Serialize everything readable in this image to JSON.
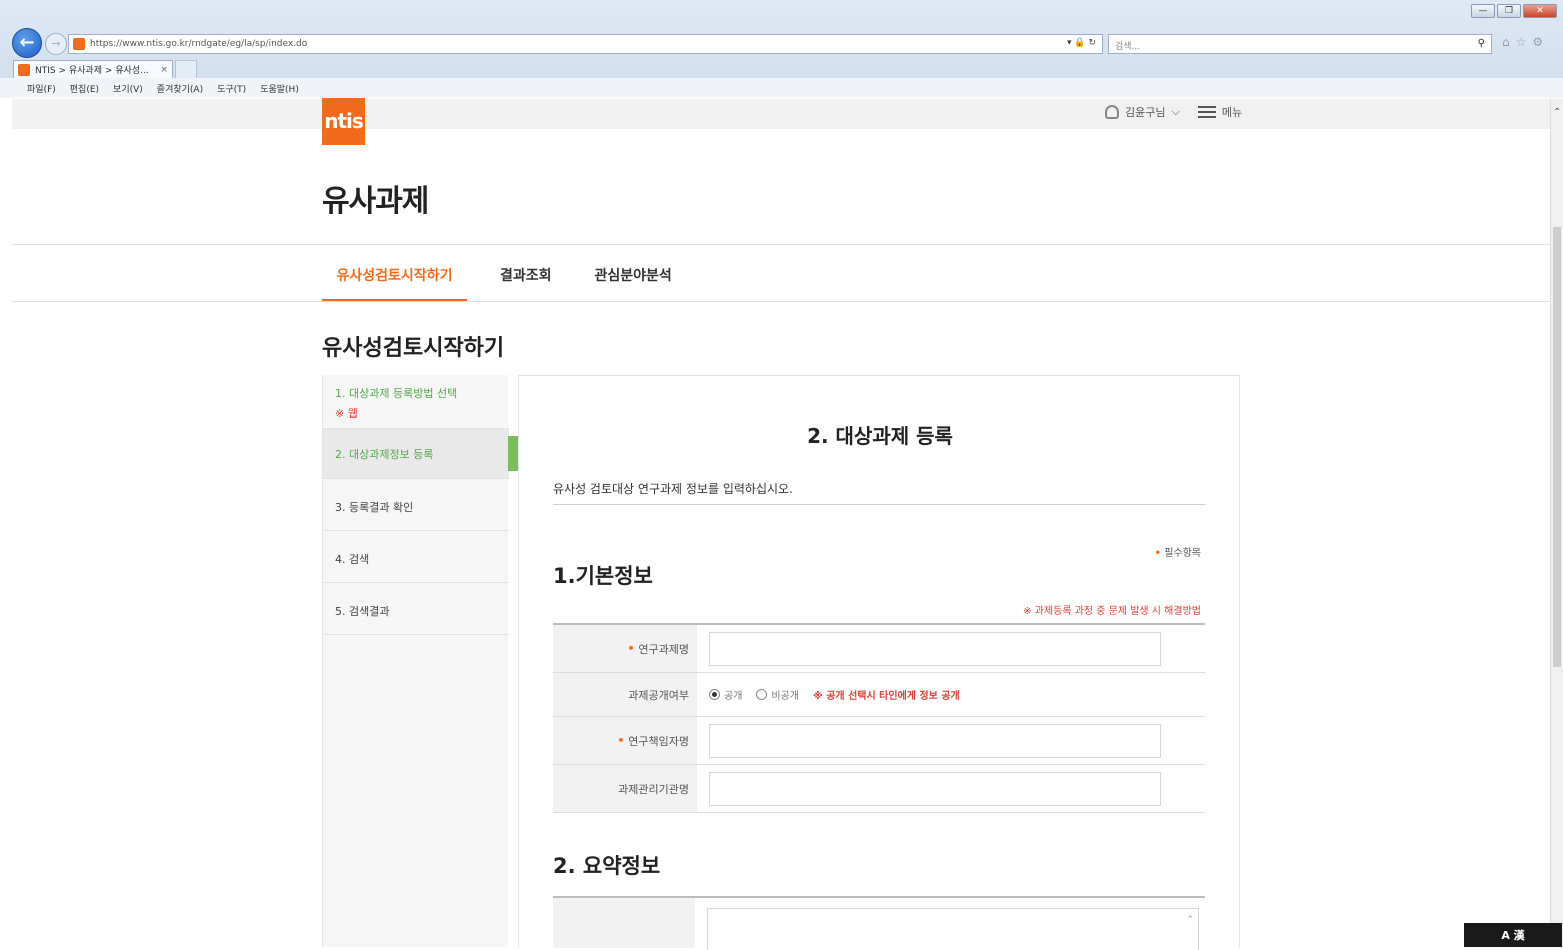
{
  "browser": {
    "url": "https://www.ntis.go.kr/rndgate/eg/la/sp/index.do",
    "search_placeholder": "검색...",
    "tab_title": "NTIS > 유사과제 > 유사성...",
    "tab_close": "×",
    "menu": [
      "파일(F)",
      "편집(E)",
      "보기(V)",
      "즐겨찾기(A)",
      "도구(T)",
      "도움말(H)"
    ],
    "addr_actions": "▾ 🔒 ↻",
    "win_controls": {
      "min": "—",
      "max": "❐",
      "close": "✕"
    }
  },
  "header": {
    "logo": "ntis",
    "user_name": "김윤구님",
    "menu_label": "메뉴"
  },
  "page": {
    "title": "유사과제",
    "tabs": [
      "유사성검토시작하기",
      "결과조회",
      "관심분야분석"
    ],
    "section_title": "유사성검토시작하기"
  },
  "steps": {
    "step1": "1. 대상과제 등록방법 선택",
    "step1_note": "※ 웹",
    "step2": "2. 대상과제정보 등록",
    "step3": "3. 등록결과 확인",
    "step4": "4. 검색",
    "step5": "5. 검색결과"
  },
  "form": {
    "title": "2. 대상과제 등록",
    "description": "유사성 검토대상 연구과제 정보를 입력하십시오.",
    "required_note": "필수항목",
    "section1": "1.기본정보",
    "issue_link": "※ 과제등록 과정 중 문제 발생 시 해결방법",
    "fields": {
      "project_name": "연구과제명",
      "disclosure": "과제공개여부",
      "researcher": "연구책임자명",
      "org": "과제관리기관명"
    },
    "radio_public": "공개",
    "radio_private": "비공개",
    "radio_note": "※ 공개 선택시 타인에게 정보 공개",
    "section2": "2. 요약정보"
  },
  "tray": "A 漢"
}
